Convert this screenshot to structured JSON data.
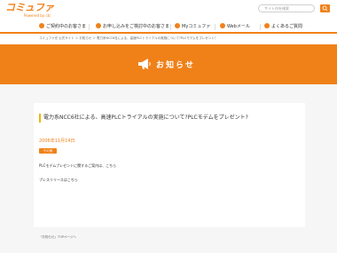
{
  "header": {
    "logo_text": "コミュファ",
    "logo_sub": "Powered by ctc",
    "search_placeholder": "サイト内を検索",
    "search_icon": "search-icon"
  },
  "nav": {
    "items": [
      {
        "label": "ご契約中のお客さま",
        "icon": "person-icon"
      },
      {
        "label": "お申し込みをご検討中のお客さま",
        "icon": "document-icon"
      },
      {
        "label": "Myコミュファ",
        "icon": "user-icon"
      },
      {
        "label": "Webメール",
        "icon": "mail-icon"
      },
      {
        "label": "よくあるご質問",
        "icon": "question-icon"
      }
    ]
  },
  "breadcrumb": "コミュファ光 公式サイト ＞ お知らせ ＞ 電力系NCC6社による、高速PLCトライアルの実施について?PLCモデムをプレゼント！",
  "hero": {
    "title": "お知らせ",
    "icon": "megaphone-icon"
  },
  "article": {
    "title": "電力系NCC6社による、高速PLCトライアルの実施について?PLCモデムをプレゼント?",
    "date": "2006年11月14日",
    "tag": "その他",
    "line1": "PLCモデムプレゼントに関するご案内は、こちら",
    "line2": "プレスリリースはこちら"
  },
  "footer": {
    "link": "「お知らせ」TOPページへ"
  },
  "colors": {
    "accent": "#f08119",
    "title_bar": "#f0b400"
  }
}
